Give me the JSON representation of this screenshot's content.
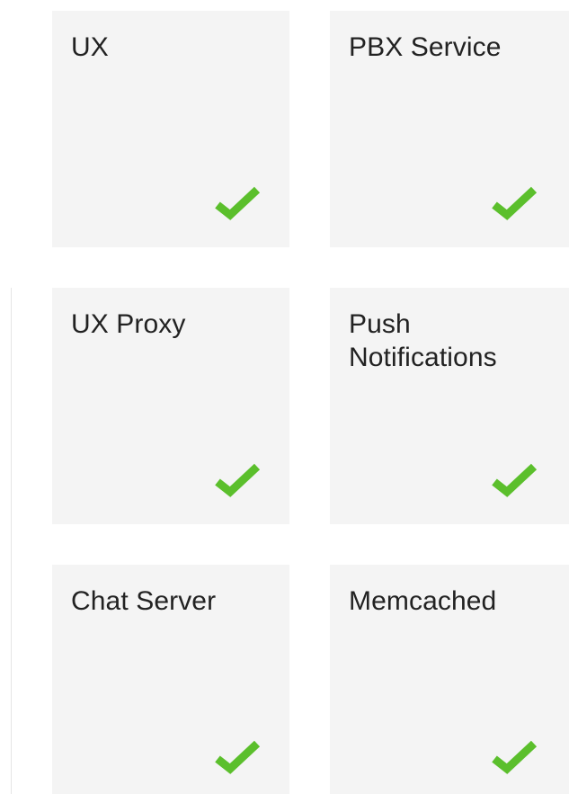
{
  "services": [
    {
      "name": "UX",
      "status": "ok",
      "status_icon": "checkmark-icon"
    },
    {
      "name": "PBX Service",
      "status": "ok",
      "status_icon": "checkmark-icon"
    },
    {
      "name": "UX Proxy",
      "status": "ok",
      "status_icon": "checkmark-icon"
    },
    {
      "name": "Push Notifications",
      "status": "ok",
      "status_icon": "checkmark-icon"
    },
    {
      "name": "Chat Server",
      "status": "ok",
      "status_icon": "checkmark-icon"
    },
    {
      "name": "Memcached",
      "status": "ok",
      "status_icon": "checkmark-icon"
    }
  ],
  "colors": {
    "tile_background": "#f4f4f4",
    "status_ok": "#5bbf2c",
    "text": "#222222"
  }
}
